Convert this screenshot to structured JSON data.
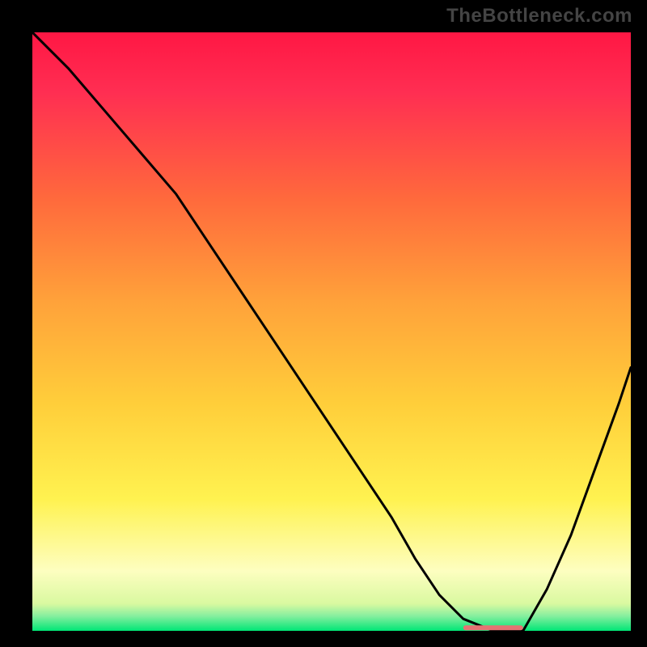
{
  "watermark": "TheBottleneck.com",
  "chart_data": {
    "type": "line",
    "title": "",
    "xlabel": "",
    "ylabel": "",
    "xlim": [
      0,
      100
    ],
    "ylim": [
      0,
      100
    ],
    "background_gradient": {
      "stops": [
        {
          "offset": 0,
          "color": "#ff1744"
        },
        {
          "offset": 0.1,
          "color": "#ff2e52"
        },
        {
          "offset": 0.28,
          "color": "#ff6a3c"
        },
        {
          "offset": 0.45,
          "color": "#ffa23a"
        },
        {
          "offset": 0.62,
          "color": "#ffce3a"
        },
        {
          "offset": 0.78,
          "color": "#fff250"
        },
        {
          "offset": 0.9,
          "color": "#fdfec0"
        },
        {
          "offset": 0.955,
          "color": "#d9f9a0"
        },
        {
          "offset": 0.975,
          "color": "#87ef9f"
        },
        {
          "offset": 1.0,
          "color": "#00e676"
        }
      ]
    },
    "series": [
      {
        "name": "bottleneck-curve",
        "color": "#000000",
        "x": [
          0,
          6,
          12,
          18,
          24,
          30,
          36,
          42,
          48,
          54,
          60,
          64,
          68,
          72,
          77,
          82,
          86,
          90,
          94,
          98,
          100
        ],
        "y": [
          100,
          94,
          87,
          80,
          73,
          64,
          55,
          46,
          37,
          28,
          19,
          12,
          6,
          2,
          0,
          0,
          7,
          16,
          27,
          38,
          44
        ]
      }
    ],
    "marker": {
      "name": "selected-range",
      "color": "#e57373",
      "x_start": 72,
      "x_end": 82,
      "y": 0.5
    }
  }
}
